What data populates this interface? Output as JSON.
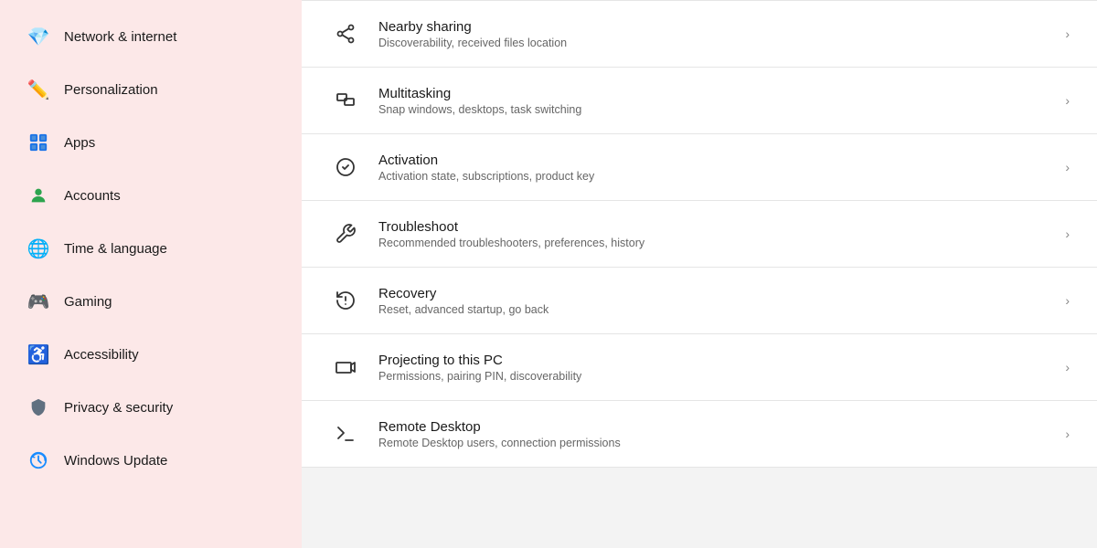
{
  "sidebar": {
    "items": [
      {
        "id": "network",
        "label": "Network & internet",
        "icon": "💎"
      },
      {
        "id": "personalization",
        "label": "Personalization",
        "icon": "✏️"
      },
      {
        "id": "apps",
        "label": "Apps",
        "icon": "🟦"
      },
      {
        "id": "accounts",
        "label": "Accounts",
        "icon": "🧑"
      },
      {
        "id": "time",
        "label": "Time & language",
        "icon": "🌐"
      },
      {
        "id": "gaming",
        "label": "Gaming",
        "icon": "🎮"
      },
      {
        "id": "accessibility",
        "label": "Accessibility",
        "icon": "♿"
      },
      {
        "id": "privacy",
        "label": "Privacy & security",
        "icon": "🛡️"
      },
      {
        "id": "update",
        "label": "Windows Update",
        "icon": "🔄"
      }
    ]
  },
  "settings": {
    "items": [
      {
        "id": "nearby-sharing",
        "title": "Nearby sharing",
        "desc": "Discoverability, received files location",
        "icon_type": "share"
      },
      {
        "id": "multitasking",
        "title": "Multitasking",
        "desc": "Snap windows, desktops, task switching",
        "icon_type": "multitask"
      },
      {
        "id": "activation",
        "title": "Activation",
        "desc": "Activation state, subscriptions, product key",
        "icon_type": "activation"
      },
      {
        "id": "troubleshoot",
        "title": "Troubleshoot",
        "desc": "Recommended troubleshooters, preferences, history",
        "icon_type": "wrench"
      },
      {
        "id": "recovery",
        "title": "Recovery",
        "desc": "Reset, advanced startup, go back",
        "icon_type": "recovery"
      },
      {
        "id": "projecting",
        "title": "Projecting to this PC",
        "desc": "Permissions, pairing PIN, discoverability",
        "icon_type": "project"
      },
      {
        "id": "remote-desktop",
        "title": "Remote Desktop",
        "desc": "Remote Desktop users, connection permissions",
        "icon_type": "remote"
      }
    ]
  }
}
